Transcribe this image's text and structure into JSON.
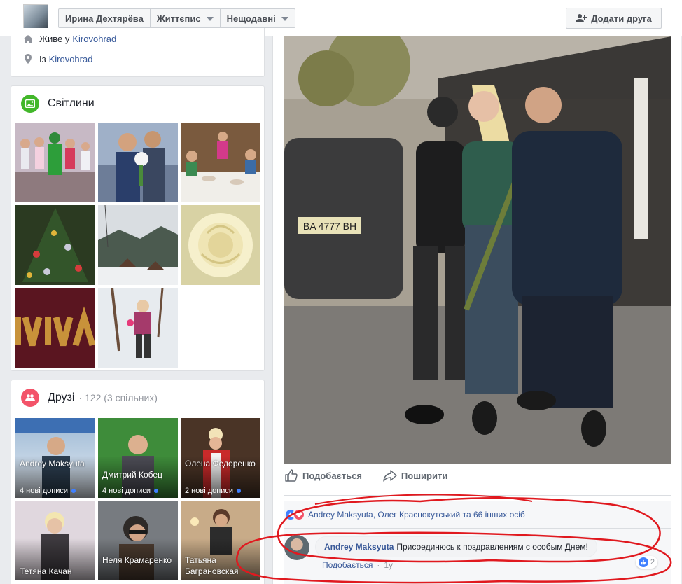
{
  "topbar": {
    "tabs": [
      {
        "label": "Ирина Дехтярёва"
      },
      {
        "label": "Життєпис"
      },
      {
        "label": "Нещодавні"
      }
    ],
    "add_friend_label": "Додати друга"
  },
  "intro": {
    "lives_prefix": "Живе у",
    "lives_city": "Kirovohrad",
    "from_prefix": "Із",
    "from_city": "Kirovohrad"
  },
  "photos": {
    "title": "Світлини"
  },
  "friends": {
    "title": "Друзі",
    "count": "· 122 (3 спільних)",
    "items": [
      {
        "name": "Andrey Maksyuta",
        "posts": "4 нові дописи"
      },
      {
        "name": "Дмитрий Кобец",
        "posts": "4 нові дописи"
      },
      {
        "name": "Олена Федоренко",
        "posts": "2 нові дописи"
      },
      {
        "name": "Тетяна Качан",
        "posts": ""
      },
      {
        "name": "Неля Крамаренко",
        "posts": ""
      },
      {
        "name": "Татьяна Баграновская",
        "posts": ""
      }
    ]
  },
  "post": {
    "plate_text": "BA 4777 BH",
    "like_label": "Подобається",
    "share_label": "Поширити",
    "reactions_text": "Andrey Maksyuta, Олег Краснокутський та 66 інших осіб",
    "comment": {
      "author": "Andrey Maksyuta",
      "text": "Присоединюсь к поздравлениям с особым Днем!",
      "like_label": "Подобається",
      "time": "1у",
      "likes": "2"
    }
  },
  "colors": {
    "link": "#365899",
    "photos_icon": "#42b72a",
    "friends_icon": "#f35369",
    "like_blue": "#4080ff",
    "love_red": "#f25268",
    "annotation_red": "#e0191f"
  }
}
